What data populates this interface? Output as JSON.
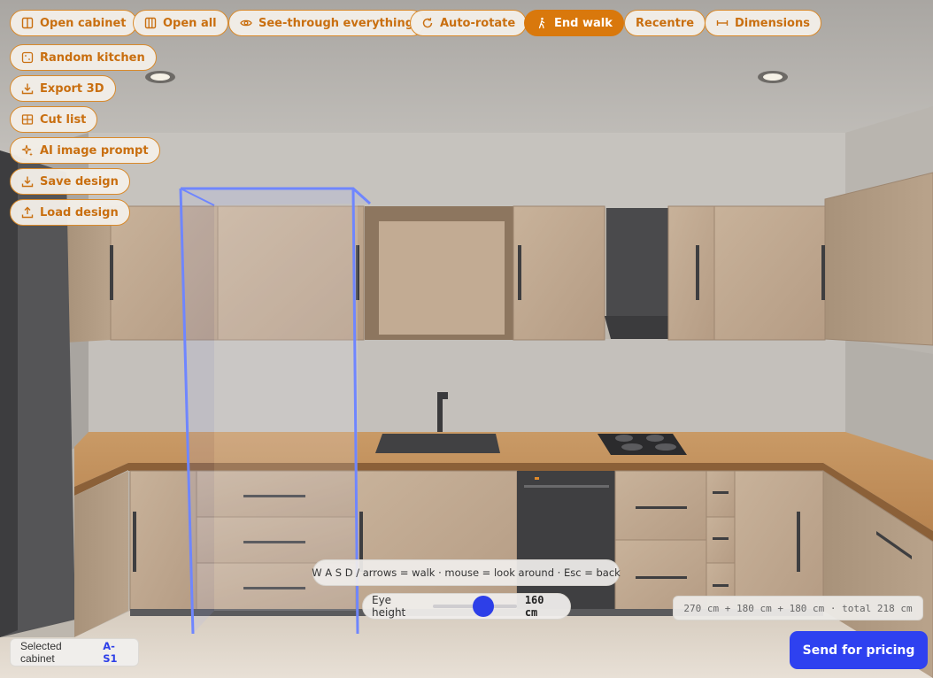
{
  "toolbar": {
    "open_cabinet": "Open cabinet",
    "open_all": "Open all",
    "see_through": "See-through everything",
    "auto_rotate": "Auto-rotate",
    "end_walk": "End walk",
    "recentre": "Recentre",
    "dimensions": "Dimensions"
  },
  "side_menu": {
    "random_kitchen": "Random kitchen",
    "export_3d": "Export 3D",
    "cut_list": "Cut list",
    "ai_image_prompt": "AI image prompt",
    "save_design": "Save design",
    "load_design": "Load design"
  },
  "walk_hint": "W A S D / arrows = walk · mouse = look around · Esc = back",
  "eye_height": {
    "label": "Eye height",
    "value": "160 cm",
    "slider_fraction": 0.57
  },
  "dimensions_readout": "270 cm + 180 cm + 180 cm · total 218 cm",
  "selected_cabinet": {
    "label": "Selected cabinet",
    "code": "A-S1"
  },
  "send_button": "Send for pricing",
  "colors": {
    "accent_orange": "#d9780c",
    "primary_blue": "#2e41f0",
    "selection_outline": "#6f86ff"
  }
}
